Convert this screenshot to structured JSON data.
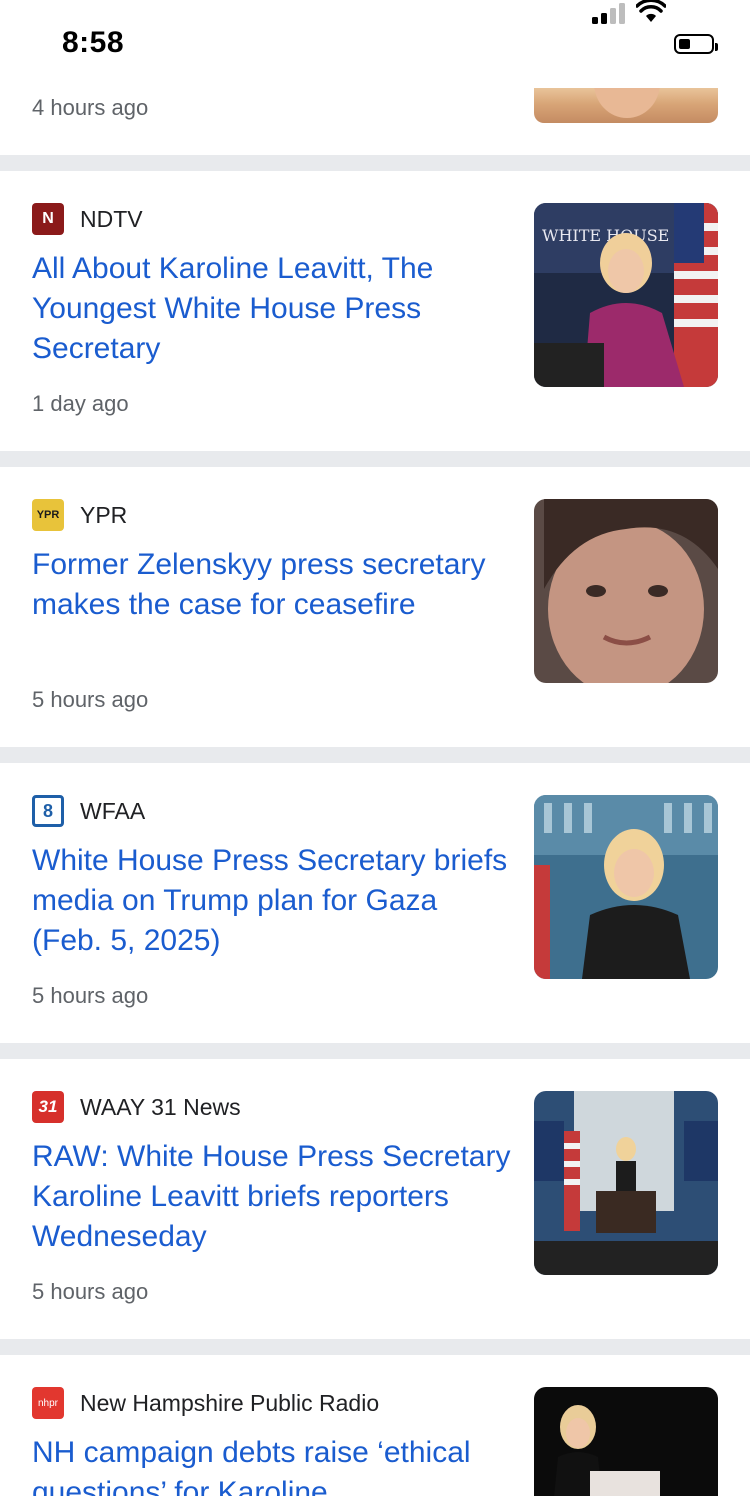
{
  "status_bar": {
    "time": "8:58"
  },
  "partial_card": {
    "time": "4 hours ago"
  },
  "articles": [
    {
      "source": "NDTV",
      "logo_text": "N",
      "logo_color": "#8b1a1a",
      "headline": "All About Karoline Leavitt, The Youngest White House Press Secretary",
      "time": "1 day ago"
    },
    {
      "source": "YPR",
      "logo_text": "YPR",
      "logo_color": "#e8c33a",
      "headline": "Former Zelenskyy press secretary makes the case for ceasefire",
      "time": "5 hours ago"
    },
    {
      "source": "WFAA",
      "logo_text": "8",
      "logo_color": "#1e5fa8",
      "headline": "White House Press Secretary briefs media on Trump plan for Gaza (Feb. 5, 2025)",
      "time": "5 hours ago"
    },
    {
      "source": "WAAY 31 News",
      "logo_text": "31",
      "logo_color": "#d6302b",
      "headline": "RAW: White House Press Secretary Karoline Leavitt briefs reporters Wedneseday",
      "time": "5 hours ago"
    },
    {
      "source": "New Hampshire Public Radio",
      "logo_text": "nhpr",
      "logo_color": "#e2372f",
      "headline": "NH campaign debts raise ‘ethical questions’ for Karoline",
      "time": ""
    }
  ],
  "theme": {
    "headline_color": "#1a5ccf",
    "separator_color": "#e8eaed",
    "meta_color": "#5f6368"
  }
}
